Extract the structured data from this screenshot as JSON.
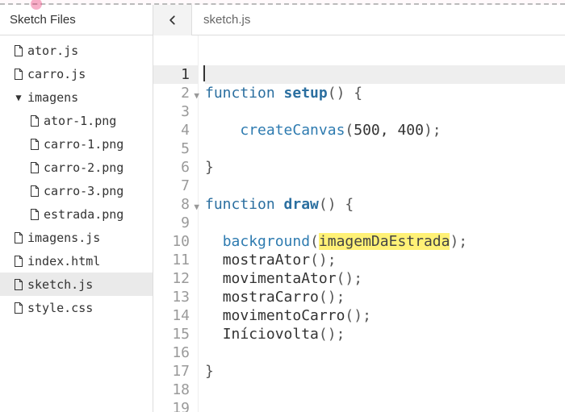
{
  "sidebar": {
    "title": "Sketch Files",
    "items": [
      {
        "label": "ator.js",
        "kind": "file",
        "depth": 0
      },
      {
        "label": "carro.js",
        "kind": "file",
        "depth": 0
      },
      {
        "label": "imagens",
        "kind": "folder",
        "depth": 0,
        "expanded": true
      },
      {
        "label": "ator-1.png",
        "kind": "file",
        "depth": 1
      },
      {
        "label": "carro-1.png",
        "kind": "file",
        "depth": 1
      },
      {
        "label": "carro-2.png",
        "kind": "file",
        "depth": 1
      },
      {
        "label": "carro-3.png",
        "kind": "file",
        "depth": 1
      },
      {
        "label": "estrada.png",
        "kind": "file",
        "depth": 1
      },
      {
        "label": "imagens.js",
        "kind": "file",
        "depth": 0
      },
      {
        "label": "index.html",
        "kind": "file",
        "depth": 0
      },
      {
        "label": "sketch.js",
        "kind": "file",
        "depth": 0,
        "selected": true
      },
      {
        "label": "style.css",
        "kind": "file",
        "depth": 0
      }
    ]
  },
  "tab": {
    "back_icon": "chevron-left",
    "filename": "sketch.js"
  },
  "editor": {
    "active_line": 1,
    "highlight": {
      "line": 10,
      "text": "imagemDaEstrada"
    },
    "lines": [
      {
        "n": 1,
        "tokens": []
      },
      {
        "n": 2,
        "fold": true,
        "tokens": [
          {
            "t": "function ",
            "c": "tok-kw"
          },
          {
            "t": "setup",
            "c": "tok-fn"
          },
          {
            "t": "() {",
            "c": "tok-paren"
          }
        ]
      },
      {
        "n": 3,
        "tokens": []
      },
      {
        "n": 4,
        "tokens": [
          {
            "t": "    ",
            "c": "tok-text"
          },
          {
            "t": "createCanvas",
            "c": "tok-call"
          },
          {
            "t": "(",
            "c": "tok-paren"
          },
          {
            "t": "500",
            "c": "tok-num"
          },
          {
            "t": ", ",
            "c": "tok-text"
          },
          {
            "t": "400",
            "c": "tok-num"
          },
          {
            "t": ");",
            "c": "tok-paren"
          }
        ]
      },
      {
        "n": 5,
        "tokens": []
      },
      {
        "n": 6,
        "tokens": [
          {
            "t": "}",
            "c": "tok-paren"
          }
        ]
      },
      {
        "n": 7,
        "tokens": []
      },
      {
        "n": 8,
        "fold": true,
        "tokens": [
          {
            "t": "function ",
            "c": "tok-kw"
          },
          {
            "t": "draw",
            "c": "tok-fn"
          },
          {
            "t": "() {",
            "c": "tok-paren"
          }
        ]
      },
      {
        "n": 9,
        "tokens": []
      },
      {
        "n": 10,
        "tokens": [
          {
            "t": "  ",
            "c": "tok-text"
          },
          {
            "t": "background",
            "c": "tok-call"
          },
          {
            "t": "(",
            "c": "tok-paren"
          },
          {
            "t": "imagemDaEstrada",
            "c": "tok-hl"
          },
          {
            "t": ");",
            "c": "tok-paren"
          }
        ]
      },
      {
        "n": 11,
        "tokens": [
          {
            "t": "  ",
            "c": "tok-text"
          },
          {
            "t": "mostraAtor",
            "c": "tok-text"
          },
          {
            "t": "();",
            "c": "tok-paren"
          }
        ]
      },
      {
        "n": 12,
        "tokens": [
          {
            "t": "  ",
            "c": "tok-text"
          },
          {
            "t": "movimentaAtor",
            "c": "tok-text"
          },
          {
            "t": "();",
            "c": "tok-paren"
          }
        ]
      },
      {
        "n": 13,
        "tokens": [
          {
            "t": "  ",
            "c": "tok-text"
          },
          {
            "t": "mostraCarro",
            "c": "tok-text"
          },
          {
            "t": "();",
            "c": "tok-paren"
          }
        ]
      },
      {
        "n": 14,
        "tokens": [
          {
            "t": "  ",
            "c": "tok-text"
          },
          {
            "t": "movimentoCarro",
            "c": "tok-text"
          },
          {
            "t": "();",
            "c": "tok-paren"
          }
        ]
      },
      {
        "n": 15,
        "tokens": [
          {
            "t": "  ",
            "c": "tok-text"
          },
          {
            "t": "Iníciovolta",
            "c": "tok-text"
          },
          {
            "t": "();",
            "c": "tok-paren"
          }
        ]
      },
      {
        "n": 16,
        "tokens": []
      },
      {
        "n": 17,
        "tokens": [
          {
            "t": "}",
            "c": "tok-paren"
          }
        ]
      },
      {
        "n": 18,
        "tokens": []
      },
      {
        "n": 19,
        "tokens": []
      }
    ]
  }
}
